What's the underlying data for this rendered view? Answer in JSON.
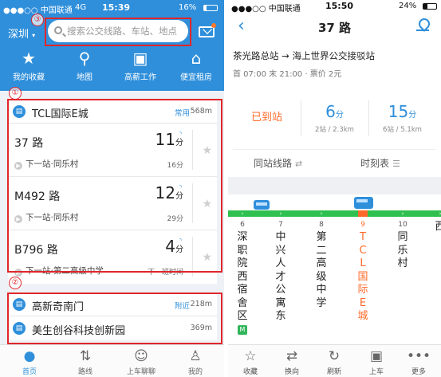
{
  "left": {
    "status": {
      "carrier": "●●●○○ 中国联通",
      "network": "4G",
      "time": "15:39",
      "battery": "16%"
    },
    "header": {
      "city": "深圳",
      "search_placeholder": "搜索公交线路、车站、地点"
    },
    "quick_links": [
      {
        "label": "我的收藏",
        "icon": "star-icon"
      },
      {
        "label": "地图",
        "icon": "map-pin-icon"
      },
      {
        "label": "高薪工作",
        "icon": "briefcase-icon"
      },
      {
        "label": "便宜租房",
        "icon": "house-icon"
      }
    ],
    "markers": {
      "one": "①",
      "two": "②",
      "three": "③"
    },
    "station_card": {
      "name": "TCL国际E城",
      "tag": "常用",
      "distance": "568m",
      "routes": [
        {
          "name": "37 路",
          "next": "下一站·同乐村",
          "minutes": "11",
          "unit": "分",
          "sub": "16分"
        },
        {
          "name": "M492 路",
          "next": "下一站·同乐村",
          "minutes": "12",
          "unit": "分",
          "sub": "29分"
        },
        {
          "name": "B796 路",
          "next": "下一站·第二高级中学",
          "minutes": "4",
          "unit": "分",
          "sub": "下一班时间"
        }
      ]
    },
    "nearby": [
      {
        "name": "高新奇南门",
        "tag": "附近",
        "distance": "218m"
      },
      {
        "name": "美生创谷科技创新园",
        "tag": "",
        "distance": "369m"
      }
    ],
    "tabbar": [
      {
        "label": "首页",
        "icon": "home-icon"
      },
      {
        "label": "路线",
        "icon": "route-icon"
      },
      {
        "label": "上车聊聊",
        "icon": "chat-icon"
      },
      {
        "label": "我的",
        "icon": "user-icon"
      }
    ]
  },
  "right": {
    "status": {
      "carrier": "●●●○○ 中国联通",
      "time": "15:50",
      "battery": "24%"
    },
    "title": "37 路",
    "direction": "茶光路总站 → 海上世界公交接驳站",
    "meta": "首 07:00 末 21:00 · 票价 2元",
    "eta": {
      "arrived": "已到站",
      "next1": {
        "minutes": "6",
        "unit": "分",
        "detail": "2站 / 2.3km"
      },
      "next2": {
        "minutes": "15",
        "unit": "分",
        "detail": "6站 / 5.1km"
      }
    },
    "tabs": {
      "same_stop": "同站线路",
      "timetable": "时刻表"
    },
    "stops": [
      {
        "num": "6",
        "name": "深职院西宿舍区"
      },
      {
        "num": "7",
        "name": "中兴人才公寓东"
      },
      {
        "num": "8",
        "name": "第二高级中学"
      },
      {
        "num": "9",
        "name": "TCL国际E城"
      },
      {
        "num": "10",
        "name": "同乐村"
      },
      {
        "num": "",
        "name": "西"
      }
    ],
    "metro_label": "M",
    "bottom_bar": [
      {
        "label": "收藏",
        "icon": "star-icon"
      },
      {
        "label": "换向",
        "icon": "swap-icon"
      },
      {
        "label": "刷新",
        "icon": "refresh-icon"
      },
      {
        "label": "上车",
        "icon": "bus-icon"
      },
      {
        "label": "更多",
        "icon": "more-icon"
      }
    ],
    "colors": {
      "accent": "#2f8fdb",
      "highlight": "#ff6a2a",
      "line": "#30c050"
    }
  }
}
